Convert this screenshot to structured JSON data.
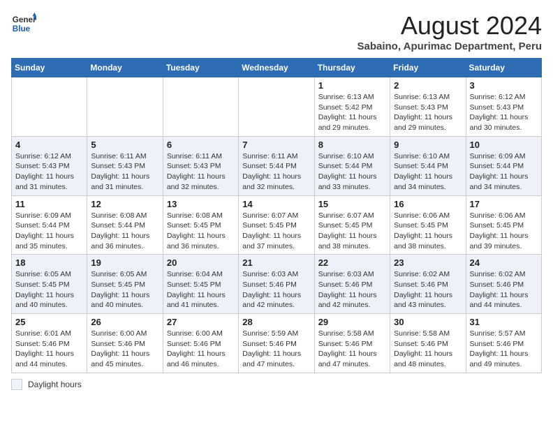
{
  "logo": {
    "general": "General",
    "blue": "Blue"
  },
  "title": "August 2024",
  "subtitle": "Sabaino, Apurimac Department, Peru",
  "days_of_week": [
    "Sunday",
    "Monday",
    "Tuesday",
    "Wednesday",
    "Thursday",
    "Friday",
    "Saturday"
  ],
  "weeks": [
    [
      {
        "day": "",
        "info": ""
      },
      {
        "day": "",
        "info": ""
      },
      {
        "day": "",
        "info": ""
      },
      {
        "day": "",
        "info": ""
      },
      {
        "day": "1",
        "info": "Sunrise: 6:13 AM\nSunset: 5:42 PM\nDaylight: 11 hours and 29 minutes."
      },
      {
        "day": "2",
        "info": "Sunrise: 6:13 AM\nSunset: 5:43 PM\nDaylight: 11 hours and 29 minutes."
      },
      {
        "day": "3",
        "info": "Sunrise: 6:12 AM\nSunset: 5:43 PM\nDaylight: 11 hours and 30 minutes."
      }
    ],
    [
      {
        "day": "4",
        "info": "Sunrise: 6:12 AM\nSunset: 5:43 PM\nDaylight: 11 hours and 31 minutes."
      },
      {
        "day": "5",
        "info": "Sunrise: 6:11 AM\nSunset: 5:43 PM\nDaylight: 11 hours and 31 minutes."
      },
      {
        "day": "6",
        "info": "Sunrise: 6:11 AM\nSunset: 5:43 PM\nDaylight: 11 hours and 32 minutes."
      },
      {
        "day": "7",
        "info": "Sunrise: 6:11 AM\nSunset: 5:44 PM\nDaylight: 11 hours and 32 minutes."
      },
      {
        "day": "8",
        "info": "Sunrise: 6:10 AM\nSunset: 5:44 PM\nDaylight: 11 hours and 33 minutes."
      },
      {
        "day": "9",
        "info": "Sunrise: 6:10 AM\nSunset: 5:44 PM\nDaylight: 11 hours and 34 minutes."
      },
      {
        "day": "10",
        "info": "Sunrise: 6:09 AM\nSunset: 5:44 PM\nDaylight: 11 hours and 34 minutes."
      }
    ],
    [
      {
        "day": "11",
        "info": "Sunrise: 6:09 AM\nSunset: 5:44 PM\nDaylight: 11 hours and 35 minutes."
      },
      {
        "day": "12",
        "info": "Sunrise: 6:08 AM\nSunset: 5:44 PM\nDaylight: 11 hours and 36 minutes."
      },
      {
        "day": "13",
        "info": "Sunrise: 6:08 AM\nSunset: 5:45 PM\nDaylight: 11 hours and 36 minutes."
      },
      {
        "day": "14",
        "info": "Sunrise: 6:07 AM\nSunset: 5:45 PM\nDaylight: 11 hours and 37 minutes."
      },
      {
        "day": "15",
        "info": "Sunrise: 6:07 AM\nSunset: 5:45 PM\nDaylight: 11 hours and 38 minutes."
      },
      {
        "day": "16",
        "info": "Sunrise: 6:06 AM\nSunset: 5:45 PM\nDaylight: 11 hours and 38 minutes."
      },
      {
        "day": "17",
        "info": "Sunrise: 6:06 AM\nSunset: 5:45 PM\nDaylight: 11 hours and 39 minutes."
      }
    ],
    [
      {
        "day": "18",
        "info": "Sunrise: 6:05 AM\nSunset: 5:45 PM\nDaylight: 11 hours and 40 minutes."
      },
      {
        "day": "19",
        "info": "Sunrise: 6:05 AM\nSunset: 5:45 PM\nDaylight: 11 hours and 40 minutes."
      },
      {
        "day": "20",
        "info": "Sunrise: 6:04 AM\nSunset: 5:45 PM\nDaylight: 11 hours and 41 minutes."
      },
      {
        "day": "21",
        "info": "Sunrise: 6:03 AM\nSunset: 5:46 PM\nDaylight: 11 hours and 42 minutes."
      },
      {
        "day": "22",
        "info": "Sunrise: 6:03 AM\nSunset: 5:46 PM\nDaylight: 11 hours and 42 minutes."
      },
      {
        "day": "23",
        "info": "Sunrise: 6:02 AM\nSunset: 5:46 PM\nDaylight: 11 hours and 43 minutes."
      },
      {
        "day": "24",
        "info": "Sunrise: 6:02 AM\nSunset: 5:46 PM\nDaylight: 11 hours and 44 minutes."
      }
    ],
    [
      {
        "day": "25",
        "info": "Sunrise: 6:01 AM\nSunset: 5:46 PM\nDaylight: 11 hours and 44 minutes."
      },
      {
        "day": "26",
        "info": "Sunrise: 6:00 AM\nSunset: 5:46 PM\nDaylight: 11 hours and 45 minutes."
      },
      {
        "day": "27",
        "info": "Sunrise: 6:00 AM\nSunset: 5:46 PM\nDaylight: 11 hours and 46 minutes."
      },
      {
        "day": "28",
        "info": "Sunrise: 5:59 AM\nSunset: 5:46 PM\nDaylight: 11 hours and 47 minutes."
      },
      {
        "day": "29",
        "info": "Sunrise: 5:58 AM\nSunset: 5:46 PM\nDaylight: 11 hours and 47 minutes."
      },
      {
        "day": "30",
        "info": "Sunrise: 5:58 AM\nSunset: 5:46 PM\nDaylight: 11 hours and 48 minutes."
      },
      {
        "day": "31",
        "info": "Sunrise: 5:57 AM\nSunset: 5:46 PM\nDaylight: 11 hours and 49 minutes."
      }
    ]
  ],
  "footer": {
    "daylight_label": "Daylight hours"
  }
}
